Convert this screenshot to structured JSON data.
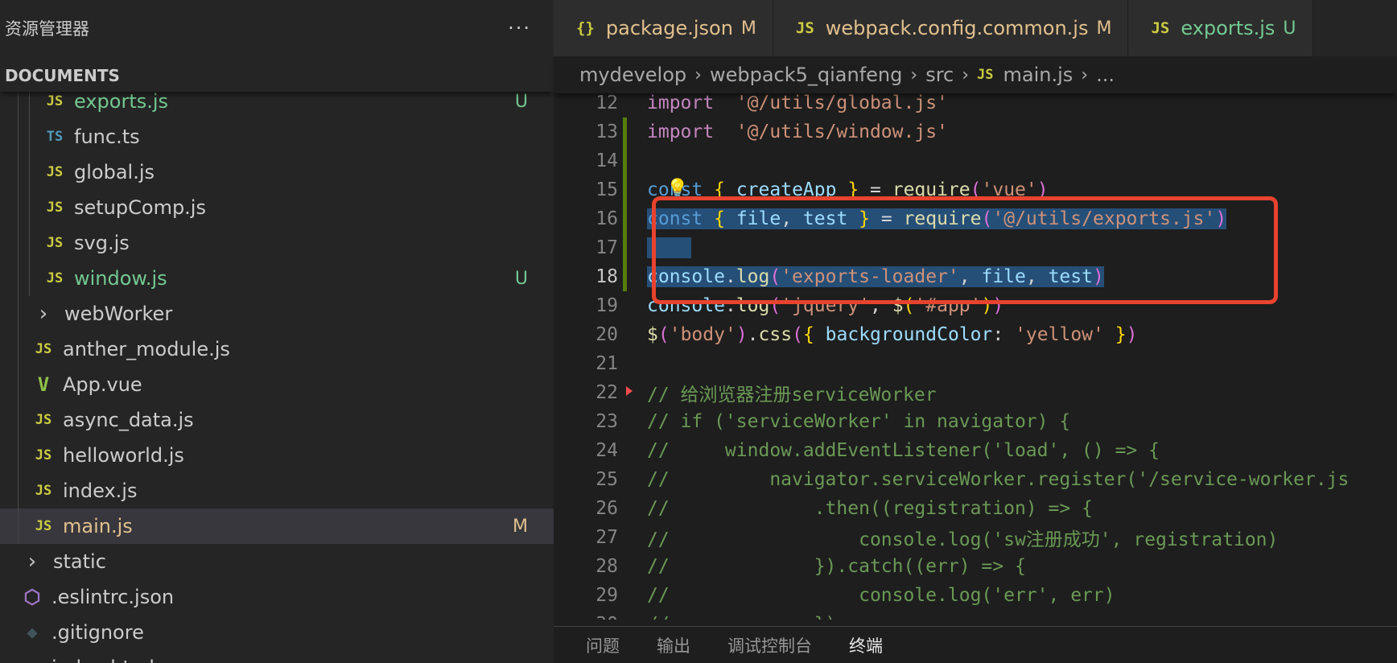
{
  "sidebar": {
    "title": "资源管理器",
    "more": "···",
    "section": "DOCUMENTS",
    "items": [
      {
        "name": "exports.js",
        "icon": "JS",
        "type": "js",
        "indent": 1,
        "status": "untracked",
        "badge": "U"
      },
      {
        "name": "func.ts",
        "icon": "TS",
        "type": "ts",
        "indent": 1,
        "status": "",
        "badge": ""
      },
      {
        "name": "global.js",
        "icon": "JS",
        "type": "js",
        "indent": 1,
        "status": "",
        "badge": ""
      },
      {
        "name": "setupComp.js",
        "icon": "JS",
        "type": "js",
        "indent": 1,
        "status": "",
        "badge": ""
      },
      {
        "name": "svg.js",
        "icon": "JS",
        "type": "js",
        "indent": 1,
        "status": "",
        "badge": ""
      },
      {
        "name": "window.js",
        "icon": "JS",
        "type": "js",
        "indent": 1,
        "status": "untracked",
        "badge": "U"
      },
      {
        "name": "webWorker",
        "icon": "›",
        "type": "folder",
        "indent": 0,
        "status": "",
        "badge": ""
      },
      {
        "name": "anther_module.js",
        "icon": "JS",
        "type": "js",
        "indent": 0,
        "status": "",
        "badge": ""
      },
      {
        "name": "App.vue",
        "icon": "V",
        "type": "vue",
        "indent": 0,
        "status": "",
        "badge": ""
      },
      {
        "name": "async_data.js",
        "icon": "JS",
        "type": "js",
        "indent": 0,
        "status": "",
        "badge": ""
      },
      {
        "name": "helloworld.js",
        "icon": "JS",
        "type": "js",
        "indent": 0,
        "status": "",
        "badge": ""
      },
      {
        "name": "index.js",
        "icon": "JS",
        "type": "js",
        "indent": 0,
        "status": "",
        "badge": ""
      },
      {
        "name": "main.js",
        "icon": "JS",
        "type": "js",
        "indent": 0,
        "status": "modified",
        "badge": "M",
        "selected": true
      },
      {
        "name": "static",
        "icon": "›",
        "type": "folder",
        "indent": -1,
        "status": "",
        "badge": ""
      },
      {
        "name": ".eslintrc.json",
        "icon": "⬡",
        "type": "eslint",
        "indent": -1,
        "status": "",
        "badge": ""
      },
      {
        "name": ".gitignore",
        "icon": "◆",
        "type": "git",
        "indent": -1,
        "status": "",
        "badge": ""
      },
      {
        "name": "index.html",
        "icon": "<>",
        "type": "html",
        "indent": -1,
        "status": "",
        "badge": ""
      }
    ]
  },
  "tabs": [
    {
      "label": "package.json",
      "icon": "{}",
      "badge": "M",
      "status": "modified"
    },
    {
      "label": "webpack.config.common.js",
      "icon": "JS",
      "badge": "M",
      "status": "modified"
    },
    {
      "label": "exports.js",
      "icon": "JS",
      "badge": "U",
      "status": "untracked"
    }
  ],
  "breadcrumb": [
    "mydevelop",
    "webpack5_qianfeng",
    "src",
    "main.js",
    "..."
  ],
  "code": [
    {
      "n": 12,
      "tokens": [
        [
          "imp",
          "import"
        ],
        [
          "",
          "  "
        ],
        [
          "str",
          "'@/utils/global.js'"
        ]
      ]
    },
    {
      "n": 13,
      "added": true,
      "tokens": [
        [
          "imp",
          "import"
        ],
        [
          "",
          "  "
        ],
        [
          "str",
          "'@/utils/window.js'"
        ]
      ]
    },
    {
      "n": 14,
      "added": true,
      "tokens": []
    },
    {
      "n": 15,
      "added": true,
      "bulb": true,
      "tokens": [
        [
          "kw",
          "const"
        ],
        [
          "",
          " "
        ],
        [
          "br1",
          "{"
        ],
        [
          "",
          " "
        ],
        [
          "var",
          "createApp"
        ],
        [
          "",
          " "
        ],
        [
          "br1",
          "}"
        ],
        [
          "",
          " = "
        ],
        [
          "fn",
          "require"
        ],
        [
          "br2",
          "("
        ],
        [
          "str",
          "'vue'"
        ],
        [
          "br2",
          ")"
        ]
      ]
    },
    {
      "n": 16,
      "added": true,
      "sel": true,
      "tokens": [
        [
          "kw",
          "const"
        ],
        [
          "",
          " "
        ],
        [
          "br1",
          "{"
        ],
        [
          "",
          " "
        ],
        [
          "var",
          "file"
        ],
        [
          "",
          ", "
        ],
        [
          "var",
          "test"
        ],
        [
          "",
          " "
        ],
        [
          "br1",
          "}"
        ],
        [
          "",
          " = "
        ],
        [
          "fn",
          "require"
        ],
        [
          "br2",
          "("
        ],
        [
          "str",
          "'@/utils/exports.js'"
        ],
        [
          "br2",
          ")"
        ]
      ]
    },
    {
      "n": 17,
      "added": true,
      "sel": true,
      "tokens": [
        [
          "",
          "    "
        ]
      ]
    },
    {
      "n": 18,
      "added": true,
      "sel": true,
      "active": true,
      "tokens": [
        [
          "var",
          "console"
        ],
        [
          "",
          "."
        ],
        [
          "fn",
          "log"
        ],
        [
          "br2",
          "("
        ],
        [
          "str",
          "'exports-loader'"
        ],
        [
          "",
          ", "
        ],
        [
          "var",
          "file"
        ],
        [
          "",
          ", "
        ],
        [
          "var",
          "test"
        ],
        [
          "br2",
          ")"
        ]
      ]
    },
    {
      "n": 19,
      "tokens": [
        [
          "var",
          "console"
        ],
        [
          "",
          "."
        ],
        [
          "fn",
          "log"
        ],
        [
          "br2",
          "("
        ],
        [
          "str",
          "'jquery'"
        ],
        [
          "",
          ", "
        ],
        [
          "fn",
          "$"
        ],
        [
          "br1",
          "("
        ],
        [
          "str",
          "'#app'"
        ],
        [
          "br1",
          ")"
        ],
        [
          "br2",
          ")"
        ]
      ]
    },
    {
      "n": 20,
      "tokens": [
        [
          "fn",
          "$"
        ],
        [
          "br2",
          "("
        ],
        [
          "str",
          "'body'"
        ],
        [
          "br2",
          ")"
        ],
        [
          "",
          "."
        ],
        [
          "fn",
          "css"
        ],
        [
          "br2",
          "("
        ],
        [
          "br1",
          "{"
        ],
        [
          "",
          " "
        ],
        [
          "var",
          "backgroundColor"
        ],
        [
          "",
          ": "
        ],
        [
          "str",
          "'yellow'"
        ],
        [
          "",
          " "
        ],
        [
          "br1",
          "}"
        ],
        [
          "br2",
          ")"
        ]
      ]
    },
    {
      "n": 21,
      "tokens": []
    },
    {
      "n": 22,
      "fold": true,
      "tokens": [
        [
          "cm",
          "// 给浏览器注册serviceWorker"
        ]
      ]
    },
    {
      "n": 23,
      "tokens": [
        [
          "cm",
          "// if ('serviceWorker' in navigator) {"
        ]
      ]
    },
    {
      "n": 24,
      "tokens": [
        [
          "cm",
          "//     window.addEventListener('load', () => {"
        ]
      ]
    },
    {
      "n": 25,
      "tokens": [
        [
          "cm",
          "//         navigator.serviceWorker.register('/service-worker.js"
        ]
      ]
    },
    {
      "n": 26,
      "tokens": [
        [
          "cm",
          "//             .then((registration) => {"
        ]
      ]
    },
    {
      "n": 27,
      "tokens": [
        [
          "cm",
          "//                 console.log('sw注册成功', registration)"
        ]
      ]
    },
    {
      "n": 28,
      "tokens": [
        [
          "cm",
          "//             }).catch((err) => {"
        ]
      ]
    },
    {
      "n": 29,
      "tokens": [
        [
          "cm",
          "//                 console.log('err', err)"
        ]
      ]
    },
    {
      "n": 30,
      "tokens": [
        [
          "cm",
          "//             })"
        ]
      ]
    }
  ],
  "panel": {
    "tabs": [
      "问题",
      "输出",
      "调试控制台",
      "终端"
    ],
    "active": 3
  }
}
